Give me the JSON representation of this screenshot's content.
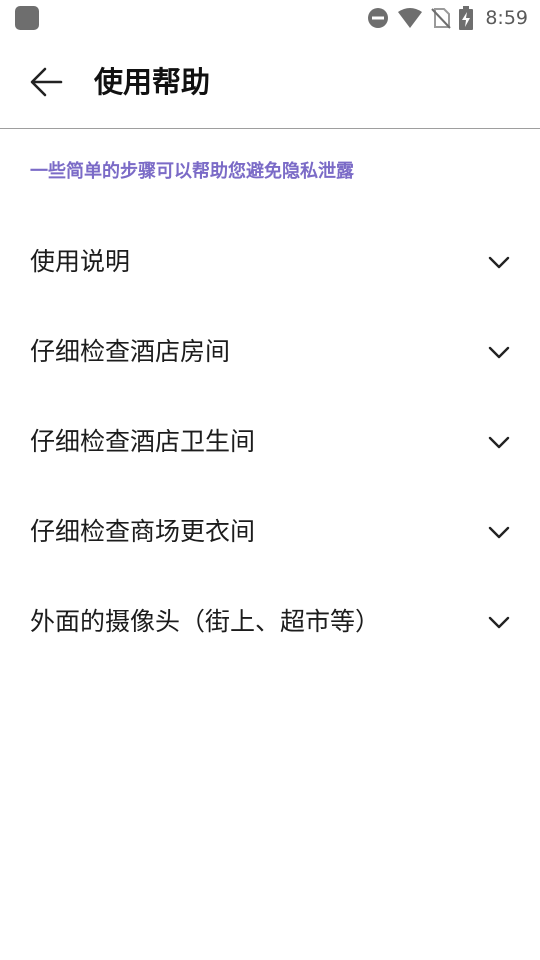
{
  "status_bar": {
    "time": "8:59",
    "icons": [
      "app-notification-icon",
      "do-not-disturb-icon",
      "wifi-icon",
      "no-sim-icon",
      "battery-charging-icon"
    ]
  },
  "header": {
    "title": "使用帮助",
    "back_icon": "arrow-left-icon"
  },
  "intro": {
    "text": "一些简单的步骤可以帮助您避免隐私泄露"
  },
  "faq": {
    "items": [
      {
        "label": "使用说明"
      },
      {
        "label": "仔细检查酒店房间"
      },
      {
        "label": "仔细检查酒店卫生间"
      },
      {
        "label": "仔细检查商场更衣间"
      },
      {
        "label": "外面的摄像头（街上、超市等）"
      }
    ],
    "expand_icon": "chevron-down-icon"
  },
  "colors": {
    "accent": "#7b6bc7",
    "divider": "#9e9e9e",
    "text": "#1c1c1c",
    "status_icons": "#6e6e6e"
  }
}
